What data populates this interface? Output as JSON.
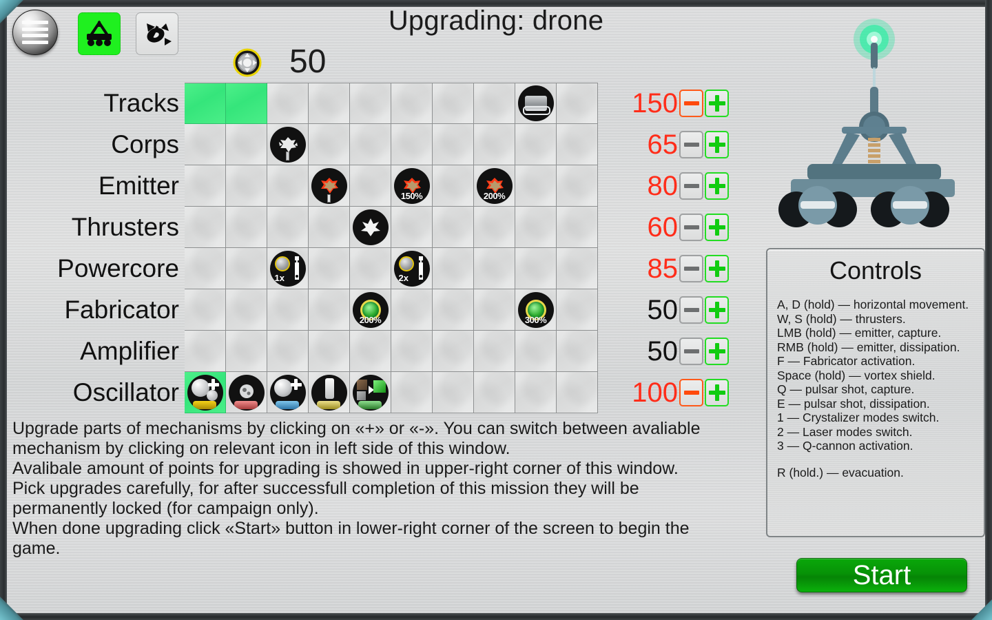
{
  "window": {
    "title": "Upgrading: drone"
  },
  "toolbar": {
    "menu_icon": "hamburger-menu-icon",
    "drone_icon": "drone-vehicle-icon",
    "satellite_icon": "satellite-icon",
    "drone_selected": true
  },
  "currency": {
    "icon": "point-token-icon",
    "value": "50"
  },
  "grid": {
    "columns": 10,
    "rows": [
      {
        "label": "Tracks",
        "price": "150",
        "affordable": false,
        "minus_enabled": true,
        "cells": [
          {
            "filled": true,
            "icon": null
          },
          {
            "filled": true,
            "icon": null
          },
          {
            "filled": false,
            "icon": null
          },
          {
            "filled": false,
            "icon": null
          },
          {
            "filled": false,
            "icon": null
          },
          {
            "filled": false,
            "icon": null
          },
          {
            "filled": false,
            "icon": null
          },
          {
            "filled": false,
            "icon": null
          },
          {
            "filled": false,
            "icon": "track-tread-icon",
            "label": ""
          },
          {
            "filled": false,
            "icon": null
          }
        ]
      },
      {
        "label": "Corps",
        "price": "65",
        "affordable": false,
        "minus_enabled": false,
        "cells": [
          {
            "filled": false,
            "icon": null
          },
          {
            "filled": false,
            "icon": null
          },
          {
            "filled": false,
            "icon": "corps-armor-icon",
            "label": ""
          },
          {
            "filled": false,
            "icon": null
          },
          {
            "filled": false,
            "icon": null
          },
          {
            "filled": false,
            "icon": null
          },
          {
            "filled": false,
            "icon": null
          },
          {
            "filled": false,
            "icon": null
          },
          {
            "filled": false,
            "icon": null
          },
          {
            "filled": false,
            "icon": null
          }
        ]
      },
      {
        "label": "Emitter",
        "price": "80",
        "affordable": false,
        "minus_enabled": false,
        "cells": [
          {
            "filled": false,
            "icon": null
          },
          {
            "filled": false,
            "icon": null
          },
          {
            "filled": false,
            "icon": null
          },
          {
            "filled": false,
            "icon": "emitter-burst-icon",
            "label": ""
          },
          {
            "filled": false,
            "icon": null
          },
          {
            "filled": false,
            "icon": "emitter-burst-icon",
            "label": "150%"
          },
          {
            "filled": false,
            "icon": null
          },
          {
            "filled": false,
            "icon": "emitter-burst-icon",
            "label": "200%"
          },
          {
            "filled": false,
            "icon": null
          },
          {
            "filled": false,
            "icon": null
          }
        ]
      },
      {
        "label": "Thrusters",
        "price": "60",
        "affordable": false,
        "minus_enabled": false,
        "cells": [
          {
            "filled": false,
            "icon": null
          },
          {
            "filled": false,
            "icon": null
          },
          {
            "filled": false,
            "icon": null
          },
          {
            "filled": false,
            "icon": null
          },
          {
            "filled": false,
            "icon": "thruster-burst-icon",
            "label": ""
          },
          {
            "filled": false,
            "icon": null
          },
          {
            "filled": false,
            "icon": null
          },
          {
            "filled": false,
            "icon": null
          },
          {
            "filled": false,
            "icon": null
          },
          {
            "filled": false,
            "icon": null
          }
        ]
      },
      {
        "label": "Powercore",
        "price": "85",
        "affordable": false,
        "minus_enabled": false,
        "cells": [
          {
            "filled": false,
            "icon": null
          },
          {
            "filled": false,
            "icon": null
          },
          {
            "filled": false,
            "icon": "powercore-wrench-icon",
            "label": "1x"
          },
          {
            "filled": false,
            "icon": null
          },
          {
            "filled": false,
            "icon": null
          },
          {
            "filled": false,
            "icon": "powercore-wrench-icon",
            "label": "2x"
          },
          {
            "filled": false,
            "icon": null
          },
          {
            "filled": false,
            "icon": null
          },
          {
            "filled": false,
            "icon": null
          },
          {
            "filled": false,
            "icon": null
          }
        ]
      },
      {
        "label": "Fabricator",
        "price": "50",
        "affordable": true,
        "minus_enabled": false,
        "cells": [
          {
            "filled": false,
            "icon": null
          },
          {
            "filled": false,
            "icon": null
          },
          {
            "filled": false,
            "icon": null
          },
          {
            "filled": false,
            "icon": null
          },
          {
            "filled": false,
            "icon": "fabricator-crystal-icon",
            "label": "200%"
          },
          {
            "filled": false,
            "icon": null
          },
          {
            "filled": false,
            "icon": null
          },
          {
            "filled": false,
            "icon": null
          },
          {
            "filled": false,
            "icon": "fabricator-crystal-icon",
            "label": "300%"
          },
          {
            "filled": false,
            "icon": null
          }
        ]
      },
      {
        "label": "Amplifier",
        "price": "50",
        "affordable": true,
        "minus_enabled": false,
        "cells": [
          {
            "filled": false,
            "icon": null
          },
          {
            "filled": false,
            "icon": null
          },
          {
            "filled": false,
            "icon": null
          },
          {
            "filled": false,
            "icon": null
          },
          {
            "filled": false,
            "icon": null
          },
          {
            "filled": false,
            "icon": null
          },
          {
            "filled": false,
            "icon": null
          },
          {
            "filled": false,
            "icon": null
          },
          {
            "filled": false,
            "icon": null
          },
          {
            "filled": false,
            "icon": null
          }
        ]
      },
      {
        "label": "Oscillator",
        "price": "100",
        "affordable": false,
        "minus_enabled": true,
        "cells": [
          {
            "filled": true,
            "icon": "oscillator-gold-icon",
            "label": ""
          },
          {
            "filled": false,
            "icon": "oscillator-rock-icon",
            "label": ""
          },
          {
            "filled": false,
            "icon": "oscillator-moon-icon",
            "label": ""
          },
          {
            "filled": false,
            "icon": "oscillator-pillar-icon",
            "label": ""
          },
          {
            "filled": false,
            "icon": "oscillator-convert-icon",
            "label": ""
          },
          {
            "filled": false,
            "icon": null
          },
          {
            "filled": false,
            "icon": null
          },
          {
            "filled": false,
            "icon": null
          },
          {
            "filled": false,
            "icon": null
          },
          {
            "filled": false,
            "icon": null
          }
        ]
      }
    ],
    "minus_label": "−",
    "plus_label": "+"
  },
  "description": [
    "Upgrade parts of mechanisms by clicking on «+» or «-». You can switch between avaliable",
    "mechanism by clicking on relevant icon in left side of this window.",
    "Avalibale amount of points for upgrading is showed in upper-right corner of this window.",
    "Pick upgrades carefully, for after successfull completion of this mission they will be",
    "permanently locked (for campaign only).",
    "When done upgrading click «Start» button in lower-right corner of the screen to begin the",
    "game."
  ],
  "preview": {
    "name": "drone-preview",
    "emitter_color": "#22e89a"
  },
  "controls": {
    "title": "Controls",
    "lines": [
      "A, D (hold) — horizontal movement.",
      "W, S (hold) — thrusters.",
      "LMB (hold) — emitter, capture.",
      "RMB (hold) — emitter, dissipation.",
      "F — Fabricator activation.",
      "Space (hold) — vortex shield.",
      "Q — pulsar shot, capture.",
      "E — pulsar shot, dissipation.",
      "1 — Crystalizer modes switch.",
      "2 — Laser modes switch.",
      "3 — Q-cannon activation."
    ],
    "footer": "R (hold.) — evacuation."
  },
  "start_button": {
    "label": "Start",
    "color": "#089008"
  }
}
